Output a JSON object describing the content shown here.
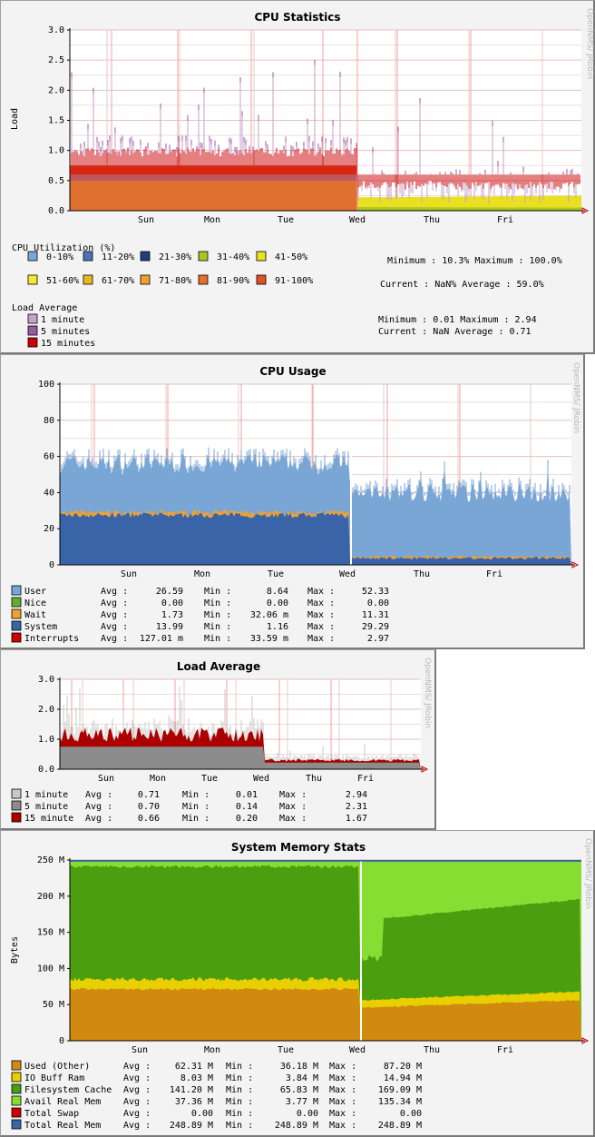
{
  "watermark": "OpenNMS/ JRobin",
  "chart_data": [
    {
      "type": "area",
      "title": "CPU Statistics",
      "ylabel": "Load",
      "ylim": [
        0,
        3
      ],
      "yticks": [
        "0.0",
        "0.5",
        "1.0",
        "1.5",
        "2.0",
        "2.5",
        "3.0"
      ],
      "day_labels": [
        "Sun",
        "Mon",
        "Tue",
        "Wed",
        "Thu",
        "Fri"
      ],
      "grid": true,
      "util_title": "CPU Utilization (%)",
      "util_series": [
        {
          "name": "0-10%",
          "color": "#7aa6d6"
        },
        {
          "name": "11-20%",
          "color": "#4a74b8"
        },
        {
          "name": "21-30%",
          "color": "#1f3f80"
        },
        {
          "name": "31-40%",
          "color": "#a8c820"
        },
        {
          "name": "41-50%",
          "color": "#e8e020"
        },
        {
          "name": "51-60%",
          "color": "#f8e830"
        },
        {
          "name": "61-70%",
          "color": "#e8b820"
        },
        {
          "name": "71-80%",
          "color": "#f0a030"
        },
        {
          "name": "81-90%",
          "color": "#e07030"
        },
        {
          "name": "91-100%",
          "color": "#e05020"
        }
      ],
      "util_stats": {
        "row1": "Minimum : 10.3%    Maximum : 100.0%",
        "row2": "Current : NaN%    Average : 59.0%"
      },
      "load_title": "Load Average",
      "load_series": [
        {
          "name": "1 minute",
          "color": "#c8a0c8"
        },
        {
          "name": "5 minutes",
          "color": "#9a5aa0"
        },
        {
          "name": "15 minutes",
          "color": "#cc0000"
        }
      ],
      "load_stats": {
        "row1": "Minimum : 0.01    Maximum : 2.94",
        "row2": "Current : NaN     Average : 0.71"
      }
    },
    {
      "type": "area",
      "title": "CPU Usage",
      "ylim": [
        0,
        100
      ],
      "yticks": [
        "0",
        "20",
        "40",
        "60",
        "80",
        "100"
      ],
      "day_labels": [
        "Sun",
        "Mon",
        "Tue",
        "Wed",
        "Thu",
        "Fri"
      ],
      "grid": true,
      "series": [
        {
          "name": "User",
          "color": "#7aa6d6",
          "avg": "26.59",
          "min": "8.64",
          "max": "52.33"
        },
        {
          "name": "Nice",
          "color": "#60b030",
          "avg": "0.00",
          "min": "0.00",
          "max": "0.00"
        },
        {
          "name": "Wait",
          "color": "#f0a030",
          "avg": "1.73",
          "min": "32.06 m",
          "max": "11.31"
        },
        {
          "name": "System",
          "color": "#3a64a8",
          "avg": "13.99",
          "min": "1.16",
          "max": "29.29"
        },
        {
          "name": "Interrupts",
          "color": "#cc0000",
          "avg": "127.01 m",
          "min": "33.59 m",
          "max": "2.97"
        }
      ]
    },
    {
      "type": "area",
      "title": "Load Average",
      "ylim": [
        0,
        3
      ],
      "yticks": [
        "0.0",
        "1.0",
        "2.0",
        "3.0"
      ],
      "day_labels": [
        "Sun",
        "Mon",
        "Tue",
        "Wed",
        "Thu",
        "Fri"
      ],
      "grid": true,
      "series": [
        {
          "name": "1  minute",
          "color": "#c8c8c8",
          "avg": "0.71",
          "min": "0.01",
          "max": "2.94"
        },
        {
          "name": "5  minute",
          "color": "#8c8c8c",
          "avg": "0.70",
          "min": "0.14",
          "max": "2.31"
        },
        {
          "name": "15 minute",
          "color": "#aa0000",
          "avg": "0.66",
          "min": "0.20",
          "max": "1.67"
        }
      ]
    },
    {
      "type": "area",
      "title": "System Memory Stats",
      "ylabel": "Bytes",
      "ylim": [
        0,
        250
      ],
      "yticks": [
        "0",
        "50 M",
        "100 M",
        "150 M",
        "200 M",
        "250 M"
      ],
      "day_labels": [
        "Sun",
        "Mon",
        "Tue",
        "Wed",
        "Thu",
        "Fri"
      ],
      "grid": true,
      "series": [
        {
          "name": "Used (Other)",
          "color": "#d08a10",
          "avg": "62.31 M",
          "min": "36.18 M",
          "max": "87.20 M"
        },
        {
          "name": "IO Buff Ram",
          "color": "#e8d000",
          "avg": "8.03 M",
          "min": "3.84 M",
          "max": "14.94 M"
        },
        {
          "name": "Filesystem Cache",
          "color": "#4a9e10",
          "avg": "141.20 M",
          "min": "65.83 M",
          "max": "169.09 M"
        },
        {
          "name": "Avail Real Mem",
          "color": "#88dd33",
          "avg": "37.36 M",
          "min": "3.77 M",
          "max": "135.34 M"
        },
        {
          "name": "Total Swap",
          "color": "#cc0000",
          "avg": "0.00",
          "min": "0.00",
          "max": "0.00"
        },
        {
          "name": "Total Real Mem",
          "color": "#3a64a8",
          "avg": "248.89 M",
          "min": "248.89 M",
          "max": "248.89 M"
        }
      ]
    }
  ]
}
